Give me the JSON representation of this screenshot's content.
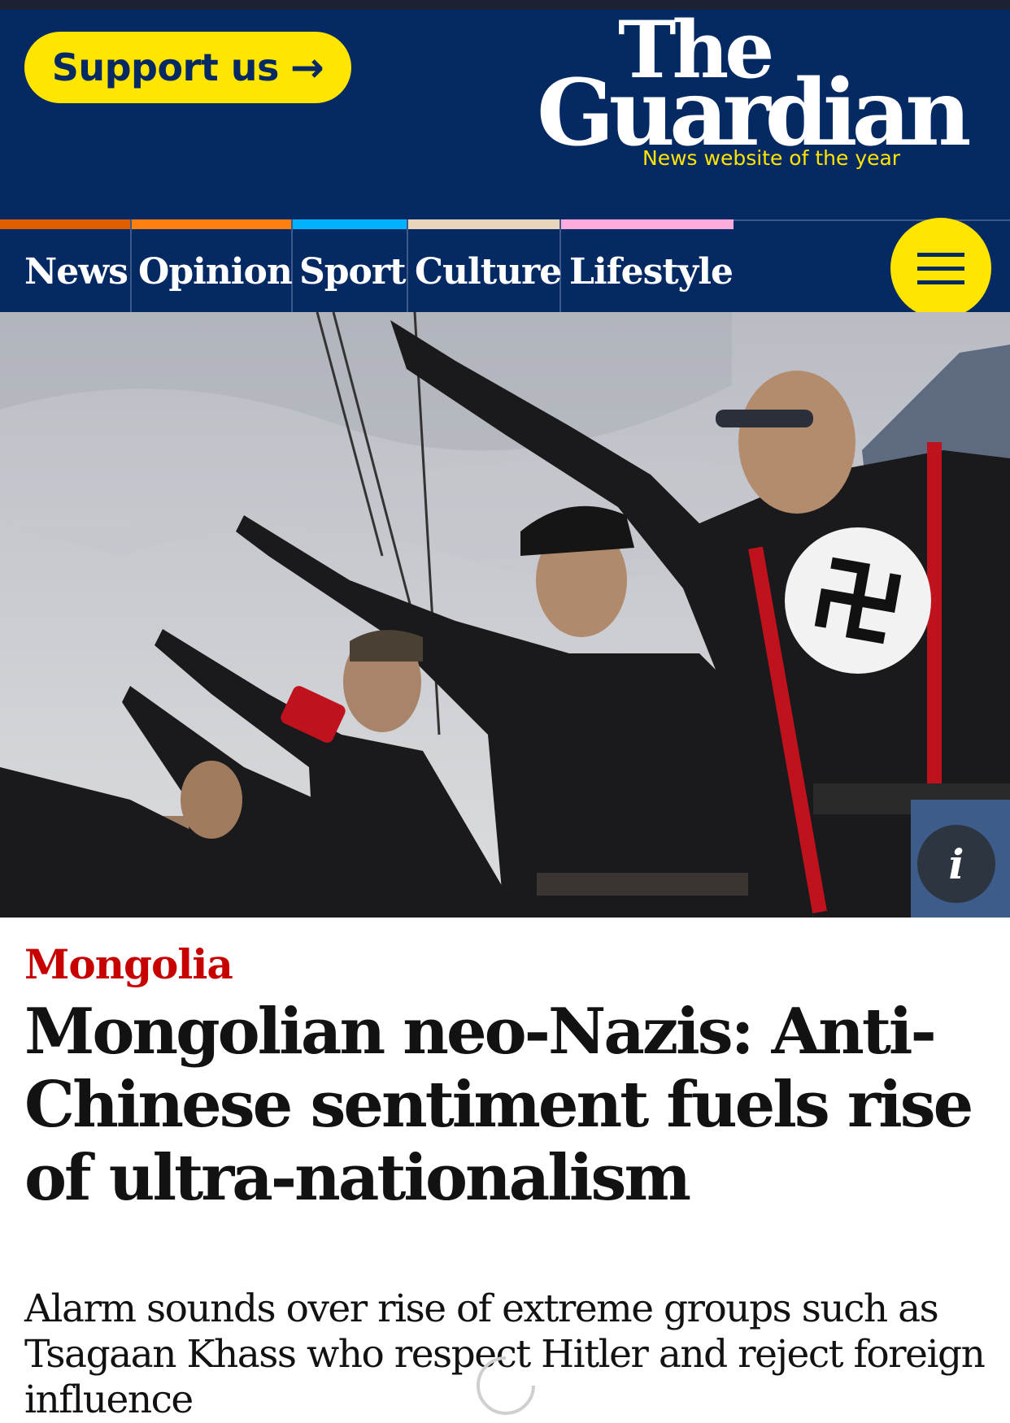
{
  "header": {
    "support_label": "Support us",
    "support_arrow": "→",
    "masthead_line1": "The",
    "masthead_line2": "Guardian",
    "tagline": "News website of the year"
  },
  "nav": {
    "items": [
      {
        "label": "News",
        "accent": "#e05e00"
      },
      {
        "label": "Opinion",
        "accent": "#ff7f0f"
      },
      {
        "label": "Sport",
        "accent": "#00b2ff"
      },
      {
        "label": "Culture",
        "accent": "#e7d4b9"
      },
      {
        "label": "Lifestyle",
        "accent": "#ffabdb"
      }
    ],
    "menu_icon": "hamburger-icon"
  },
  "hero": {
    "info_label": "i"
  },
  "article": {
    "kicker": "Mongolia",
    "headline": "Mongolian neo-Nazis: Anti-Chinese sentiment fuels rise of ultra-nationalism",
    "standfirst": "Alarm sounds over rise of extreme groups such as Tsagaan Khass who respect Hitler and reject foreign influence"
  },
  "colors": {
    "brand_blue": "#052962",
    "accent_yellow": "#ffe500",
    "kicker_red": "#c70000"
  }
}
